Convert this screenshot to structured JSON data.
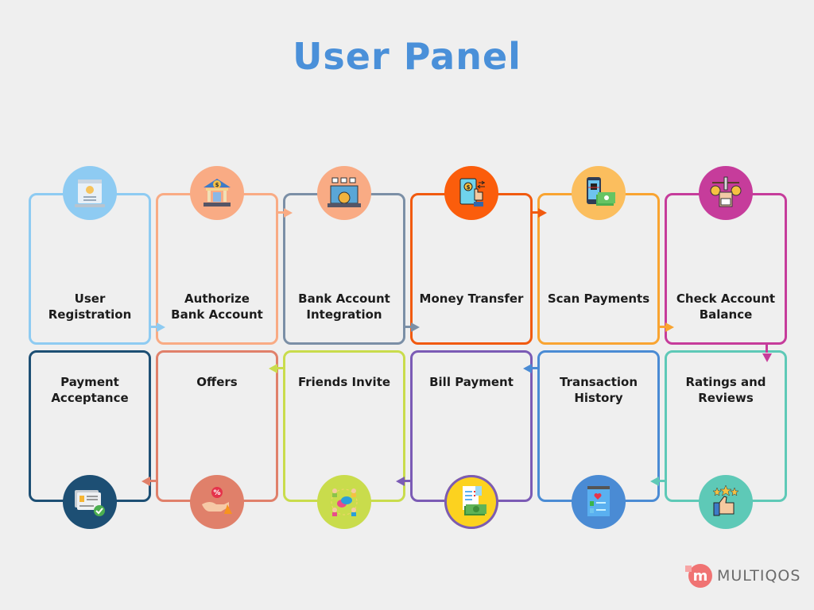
{
  "title": "User Panel",
  "steps": [
    {
      "label": "User\nRegistration",
      "icon": "user-registration-icon",
      "color": "#8ecbf2",
      "circle": "#8ecbf2"
    },
    {
      "label": "Authorize\nBank Account",
      "icon": "bank-icon",
      "color": "#f9ab84",
      "circle": "#f9ab84"
    },
    {
      "label": "Bank Account\nIntegration",
      "icon": "laptop-integration-icon",
      "color": "#7b8fa6",
      "circle": "#f9ab84"
    },
    {
      "label": "Money Transfer",
      "icon": "money-transfer-icon",
      "color": "#f15a0f",
      "circle": "#fb5d0c"
    },
    {
      "label": "Scan Payments",
      "icon": "qr-scan-payment-icon",
      "color": "#f9a431",
      "circle": "#fbbe5e"
    },
    {
      "label": "Check Account\nBalance",
      "icon": "balance-scale-icon",
      "color": "#c63c9b",
      "circle": "#c63c9b"
    },
    {
      "label": "Ratings and\nReviews",
      "icon": "thumbs-up-stars-icon",
      "color": "#5ec9b7",
      "circle": "#5ec9b7"
    },
    {
      "label": "Transaction\nHistory",
      "icon": "transaction-history-icon",
      "color": "#4a8bd4",
      "circle": "#4a8bd4"
    },
    {
      "label": "Bill Payment",
      "icon": "bill-receipt-icon",
      "color": "#7b5bb5",
      "circle": "#fcd21f"
    },
    {
      "label": "Friends Invite",
      "icon": "friends-chat-icon",
      "color": "#c9dc4c",
      "circle": "#c9dc4c"
    },
    {
      "label": "Offers",
      "icon": "discount-offer-icon",
      "color": "#e0806a",
      "circle": "#e0806a"
    },
    {
      "label": "Payment\nAcceptance",
      "icon": "payment-accepted-icon",
      "color": "#1d4f74",
      "circle": "#1d4f74"
    }
  ],
  "logo": {
    "mark": "m",
    "text": "MULTIQOS",
    "color": "#f07373"
  }
}
